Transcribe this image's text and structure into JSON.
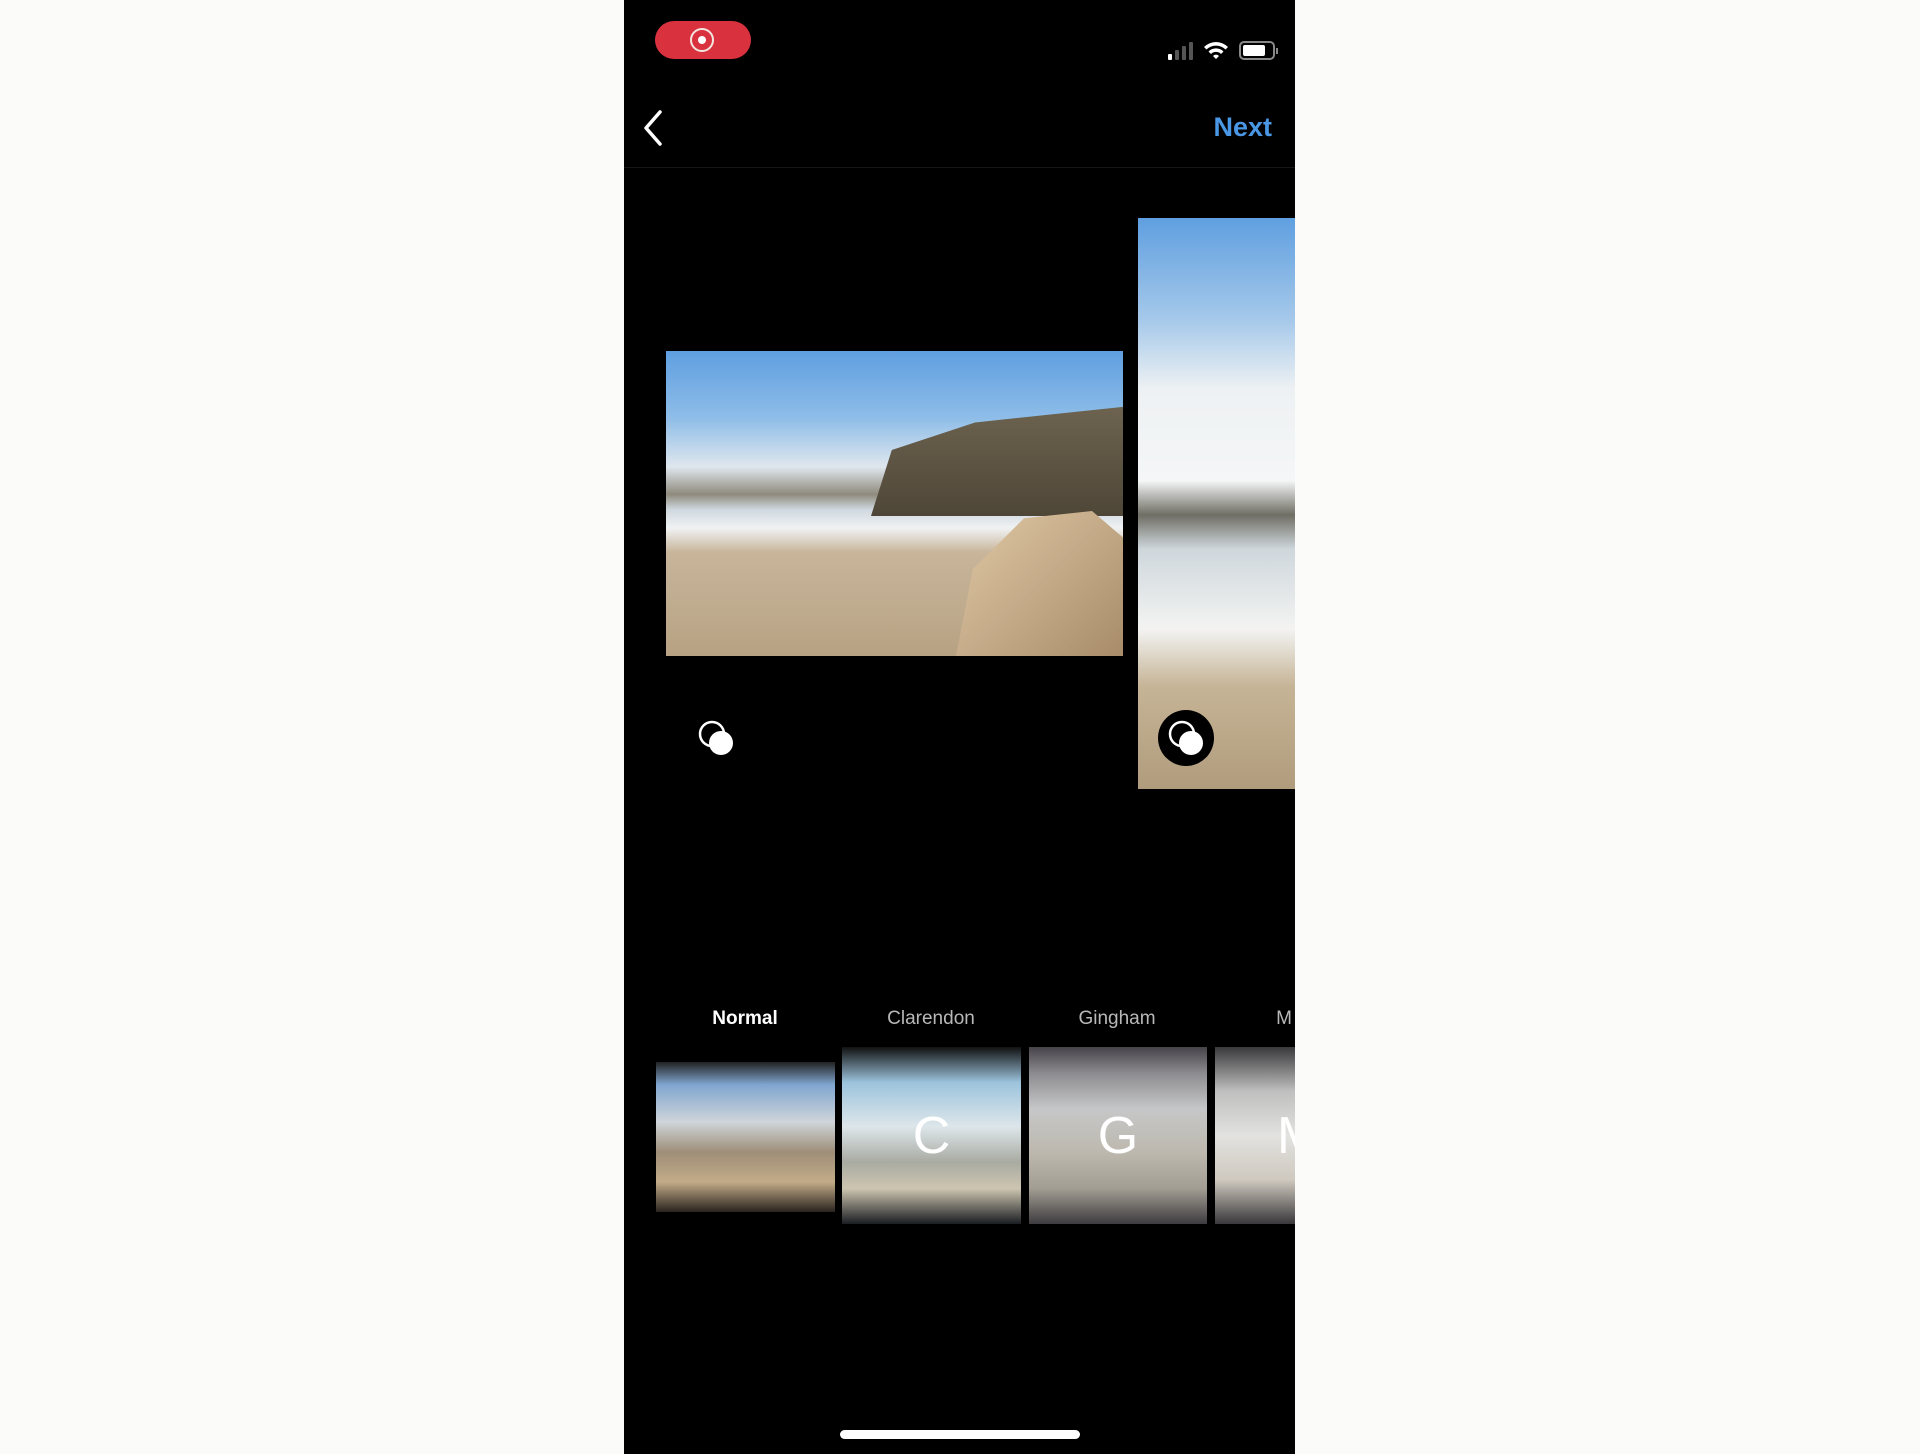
{
  "status_bar": {
    "recording_icon": "screen-record-icon",
    "signal_icon": "cellular-signal-icon",
    "wifi_icon": "wifi-icon",
    "battery_icon": "battery-icon",
    "battery_level": 0.8,
    "signal_bars_active": 1,
    "signal_bars_total": 4,
    "record_color": "#d9313d"
  },
  "nav": {
    "back_icon": "chevron-left-icon",
    "next_label": "Next",
    "accent": "#4a98e5"
  },
  "carousel": {
    "photos": [
      {
        "name": "beach-photo-1",
        "multi_icon": "multi-select-icon"
      },
      {
        "name": "beach-photo-2",
        "multi_icon": "multi-select-icon"
      }
    ]
  },
  "filters": [
    {
      "label": "Normal",
      "letter": "",
      "selected": true
    },
    {
      "label": "Clarendon",
      "letter": "C",
      "selected": false
    },
    {
      "label": "Gingham",
      "letter": "G",
      "selected": false
    },
    {
      "label": "M",
      "letter": "M",
      "selected": false
    }
  ]
}
